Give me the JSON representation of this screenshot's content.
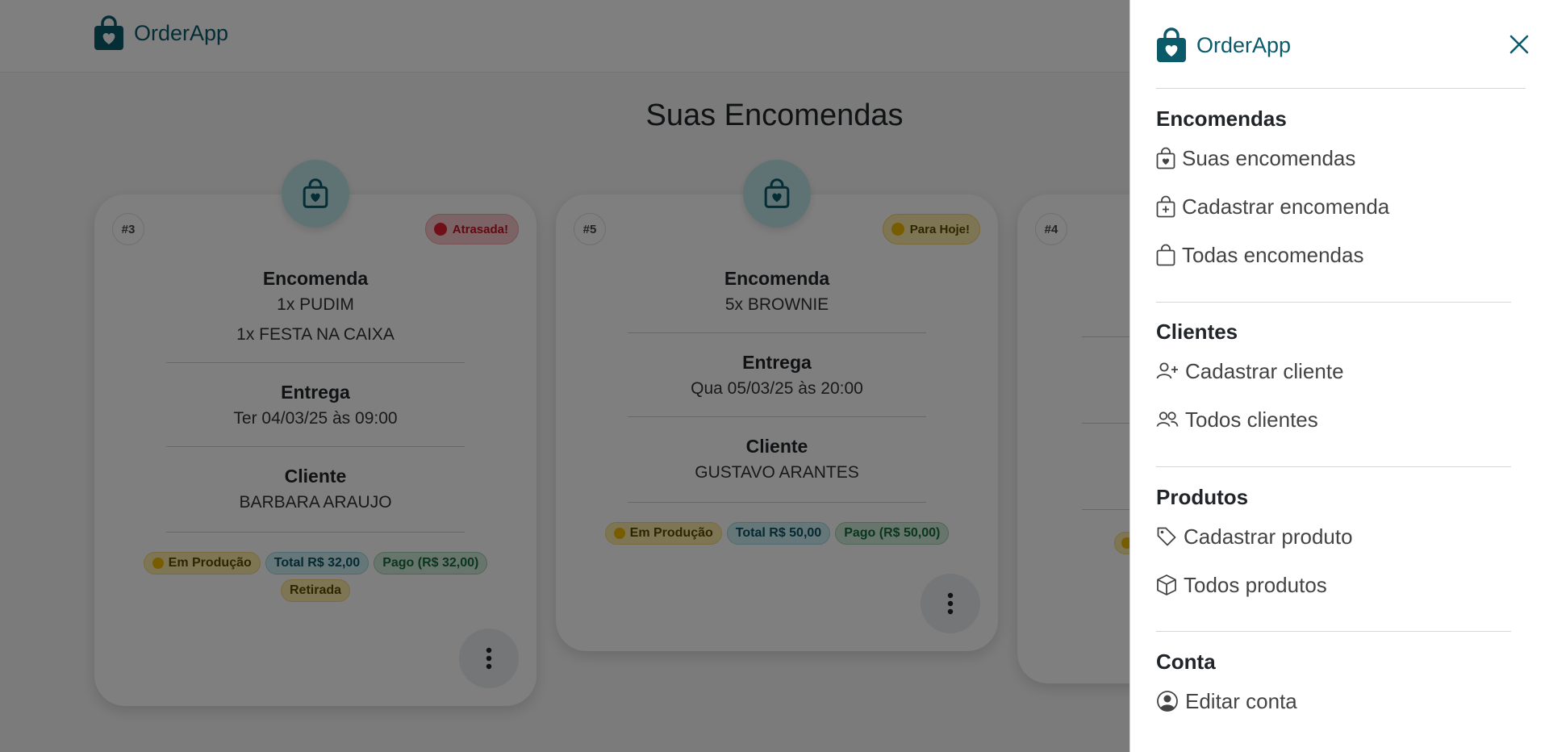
{
  "app": {
    "brand": "OrderApp"
  },
  "page": {
    "title": "Suas Encomendas"
  },
  "cards": [
    {
      "number": "#3",
      "status": "Atrasada!",
      "order_heading": "Encomenda",
      "items": [
        "1x PUDIM",
        "1x FESTA NA CAIXA"
      ],
      "delivery_heading": "Entrega",
      "delivery": "Ter 04/03/25 às 09:00",
      "client_heading": "Cliente",
      "client": "BARBARA ARAUJO",
      "tags": {
        "production": "Em Produção",
        "total": "Total R$ 32,00",
        "paid": "Pago (R$ 32,00)",
        "pickup": "Retirada"
      }
    },
    {
      "number": "#5",
      "status": "Para Hoje!",
      "order_heading": "Encomenda",
      "items": [
        "5x BROWNIE"
      ],
      "delivery_heading": "Entrega",
      "delivery": "Qua 05/03/25 às 20:00",
      "client_heading": "Cliente",
      "client": "GUSTAVO ARANTES",
      "tags": {
        "production": "Em Produção",
        "total": "Total R$ 50,00",
        "paid": "Pago (R$ 50,00)"
      }
    },
    {
      "number": "#4"
    }
  ],
  "menu": {
    "brand": "OrderApp",
    "orders": {
      "heading": "Encomendas",
      "items": [
        "Suas encomendas",
        "Cadastrar encomenda",
        "Todas encomendas"
      ]
    },
    "clients": {
      "heading": "Clientes",
      "items": [
        "Cadastrar cliente",
        "Todos clientes"
      ]
    },
    "products": {
      "heading": "Produtos",
      "items": [
        "Cadastrar produto",
        "Todos produtos"
      ]
    },
    "account": {
      "heading": "Conta",
      "items": [
        "Editar conta"
      ]
    }
  },
  "icons": {
    "brand": "shopping-bag-heart-icon",
    "close": "close-icon",
    "more": "three-dots-vertical-icon"
  },
  "colors": {
    "brand": "#0b5a6a",
    "late": "#e01e2d",
    "today": "#f1b800",
    "overlay": "rgba(0,0,0,0.5)"
  }
}
